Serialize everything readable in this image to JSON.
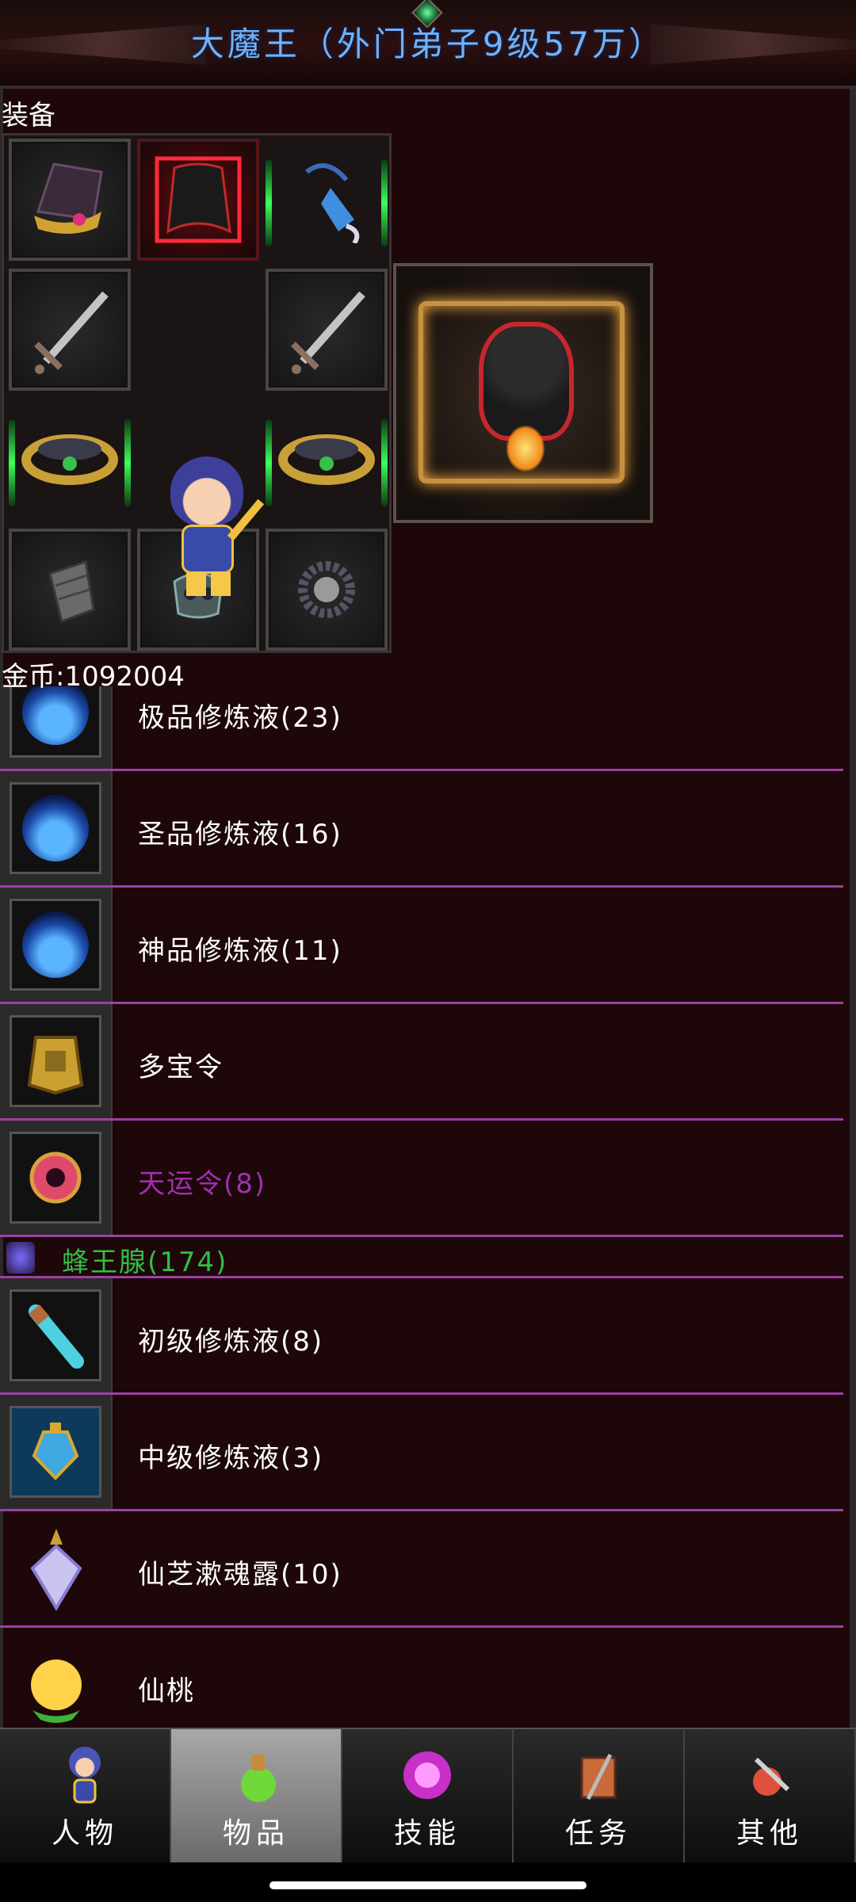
{
  "header": {
    "title": "大魔王（外门弟子9级57万）"
  },
  "equipment": {
    "label": "装备",
    "slots": [
      {
        "name": "helmet",
        "icon": "hat"
      },
      {
        "name": "cape",
        "icon": "cape"
      },
      {
        "name": "amulet",
        "icon": "pendant"
      },
      {
        "name": "weapon-left",
        "icon": "sword"
      },
      {
        "name": "weapon-right",
        "icon": "sword"
      },
      {
        "name": "ring-left",
        "icon": "ring"
      },
      {
        "name": "ring-right",
        "icon": "ring"
      },
      {
        "name": "bracer",
        "icon": "bracer"
      },
      {
        "name": "boots",
        "icon": "boots"
      },
      {
        "name": "beads",
        "icon": "beads"
      }
    ],
    "mount_icon": "dark-creature"
  },
  "gold": {
    "text": "金币:1092004"
  },
  "items": [
    {
      "label": "极品修炼液(23)",
      "icon": "blue-potion"
    },
    {
      "label": "圣品修炼液(16)",
      "icon": "blue-potion"
    },
    {
      "label": "神品修炼液(11)",
      "icon": "blue-potion"
    },
    {
      "label": "多宝令",
      "icon": "gold-token"
    },
    {
      "label": "天运令(8)",
      "icon": "red-token",
      "color": "#a02fb3"
    },
    {
      "label": "蜂王腺(174)",
      "icon": "bee-gland",
      "color": "#2fbf46"
    },
    {
      "label": "初级修炼液(8)",
      "icon": "vial"
    },
    {
      "label": "中级修炼液(3)",
      "icon": "elixir"
    },
    {
      "label": "仙芝漱魂露(10)",
      "icon": "crystal-bottle"
    },
    {
      "label": "仙桃",
      "icon": "peach"
    }
  ],
  "tabs": [
    {
      "label": "人物",
      "icon": "character-icon",
      "active": false
    },
    {
      "label": "物品",
      "icon": "potion-icon",
      "active": true
    },
    {
      "label": "技能",
      "icon": "skill-orb-icon",
      "active": false
    },
    {
      "label": "任务",
      "icon": "quest-icon",
      "active": false
    },
    {
      "label": "其他",
      "icon": "misc-icon",
      "active": false
    }
  ]
}
